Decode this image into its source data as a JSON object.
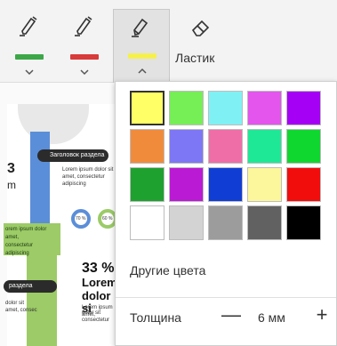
{
  "toolbar": {
    "tools": [
      {
        "name": "pen-green",
        "color": "#3da748",
        "active": false
      },
      {
        "name": "pen-red",
        "color": "#d93a3a",
        "active": false
      },
      {
        "name": "highlighter-yellow",
        "color": "#f5f04d",
        "active": true
      }
    ],
    "eraser_label": "Ластик"
  },
  "document": {
    "heading_pill": "Заголовок раздела",
    "heading_pill2": "раздела",
    "big_number": "3",
    "big_unit": "m",
    "line1": "Lorem ipsum dolor sit",
    "line2": "amet, consectetur",
    "line3": "adipiscing",
    "band1": "orem ipsum dolor",
    "band2": "amet,",
    "band3": "consectetur",
    "band4": "adipiscing",
    "donut1": "70 %",
    "donut2": "60 %",
    "percent": "33 %",
    "lorem1": "Lorem",
    "lorem2": "dolor si",
    "small1": "dolor sit",
    "small2": "amet, consec",
    "small3": "Lorem ipsum dolor sit",
    "small4": "amet, consectetur"
  },
  "popup": {
    "colors": [
      "#ffff66",
      "#76ee55",
      "#7ff1f4",
      "#e355ec",
      "#a500f5",
      "#f18b3c",
      "#7e77f5",
      "#f06ea8",
      "#1ee896",
      "#10d630",
      "#1ea12e",
      "#bb1ad5",
      "#103ed5",
      "#fcf79c",
      "#f20d0d",
      "#ffffff",
      "#d3d3d3",
      "#9c9c9c",
      "#616161",
      "#000000"
    ],
    "selected_index": 0,
    "other_colors_label": "Другие цвета",
    "thickness_label": "Толщина",
    "thickness_value": "6 мм",
    "minus_label": "—",
    "plus_label": "+"
  }
}
